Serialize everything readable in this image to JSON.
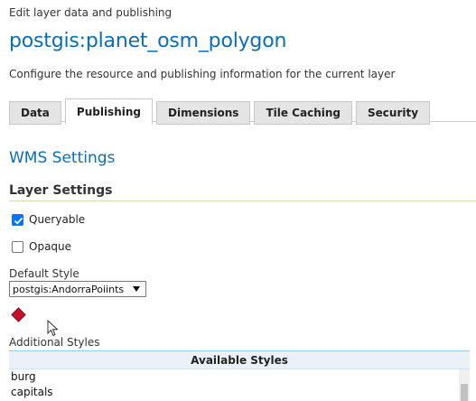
{
  "breadcrumb": "Edit layer data and publishing",
  "layer_title": "postgis:planet_osm_polygon",
  "subtitle": "Configure the resource and publishing information for the current layer",
  "tabs": [
    {
      "label": "Data",
      "active": false
    },
    {
      "label": "Publishing",
      "active": true
    },
    {
      "label": "Dimensions",
      "active": false
    },
    {
      "label": "Tile Caching",
      "active": false
    },
    {
      "label": "Security",
      "active": false
    }
  ],
  "wms_settings_title": "WMS Settings",
  "layer_settings_heading": "Layer Settings",
  "queryable": {
    "label": "Queryable",
    "checked": true
  },
  "opaque": {
    "label": "Opaque",
    "checked": false
  },
  "default_style": {
    "label": "Default Style",
    "selected": "postgis:AndorraPoiints"
  },
  "legend_icon": "red-diamond-icon",
  "additional_styles": {
    "label": "Additional Styles",
    "header": "Available Styles",
    "items": [
      "burg",
      "capitals"
    ]
  },
  "colors": {
    "accent": "#0b6eb4",
    "checkbox": "#0075ff",
    "legend_fill": "#c8102e"
  }
}
